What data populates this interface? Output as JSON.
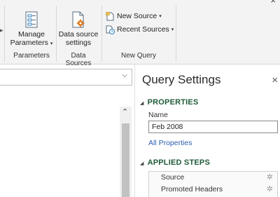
{
  "window": {
    "close_glyph": "×"
  },
  "ribbon": {
    "groups": [
      {
        "label": "Parameters",
        "buttons": [
          {
            "line1": "Manage",
            "line2": "Parameters",
            "icon": "manage-parameters-icon",
            "has_caret": true
          }
        ]
      },
      {
        "label": "Data Sources",
        "buttons": [
          {
            "line1": "Data source",
            "line2": "settings",
            "icon": "data-source-settings-icon"
          }
        ]
      },
      {
        "label": "New Query",
        "buttons": [
          {
            "label": "New Source",
            "icon": "new-source-icon",
            "has_caret": true
          },
          {
            "label": "Recent Sources",
            "icon": "recent-sources-icon",
            "has_caret": true
          }
        ]
      }
    ]
  },
  "query_settings": {
    "title": "Query Settings",
    "close_glyph": "×",
    "properties": {
      "heading": "PROPERTIES",
      "name_label": "Name",
      "name_value": "Feb 2008",
      "all_properties_link": "All Properties"
    },
    "applied_steps": {
      "heading": "APPLIED STEPS",
      "steps": [
        {
          "label": "Source"
        },
        {
          "label": "Promoted Headers"
        }
      ]
    }
  },
  "colors": {
    "accent_green": "#1f5a38",
    "link_blue": "#2a5db0",
    "icon_orange": "#e07a1f"
  }
}
